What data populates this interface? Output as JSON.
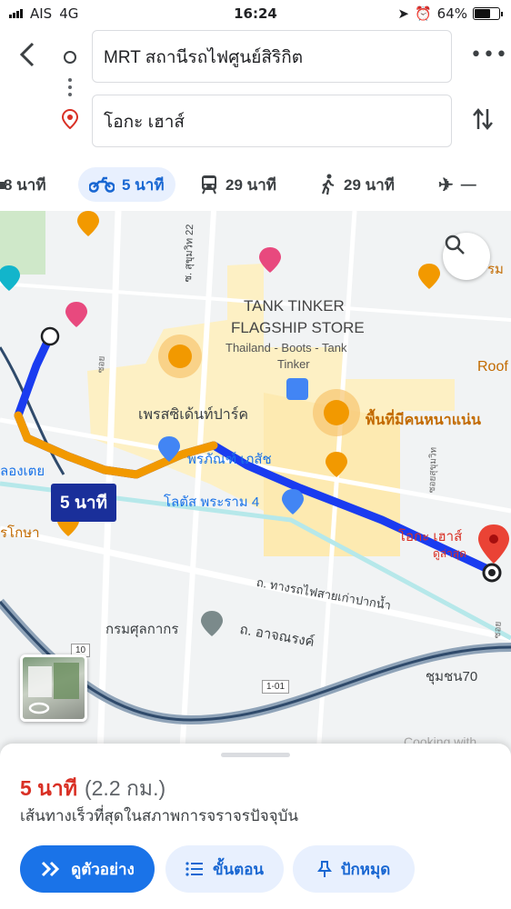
{
  "status_bar": {
    "carrier": "AIS",
    "network": "4G",
    "time": "16:24",
    "battery": "64%"
  },
  "route": {
    "origin": "MRT สถานีรถไฟศูนย์สิริกิต",
    "destination": "โอกะ เฮาส์"
  },
  "modes": [
    {
      "icon": "car-icon",
      "label": "8 นาที"
    },
    {
      "icon": "motorcycle-icon",
      "label": "5 นาที",
      "active": true
    },
    {
      "icon": "transit-icon",
      "label": "29 นาที"
    },
    {
      "icon": "walk-icon",
      "label": "29 นาที"
    },
    {
      "icon": "flight-icon",
      "label": "—"
    }
  ],
  "map": {
    "labels": {
      "tank_tinker_1": "TANK TINKER",
      "tank_tinker_2": "FLAGSHIP STORE",
      "thailand_boots": "Thailand - Boots - Tank",
      "tinker": "Tinker",
      "park": "เพรสซิเด้นท์ปาร์ค",
      "crowded": "พื้นที่มีคนหนาแน่น",
      "pharmacy": "พรภัณฑ์ เภสัช",
      "lotus": "โลตัส พระราม 4",
      "khlong_toei": "ลองเตย",
      "road_rail": "ถ. ทางรถไฟสายเก่าปากน้ำ",
      "customs": "กรมศุลกากร",
      "arjnarong": "ถ. อาจณรงค์",
      "chumchon": "ชุมชน70",
      "dest_name": "โอกะ เฮาส์",
      "dest_sub": "ดูล่าสุด",
      "roof": "Roof",
      "sukhumvit": "ซ. สุขุมวิท 22",
      "rongkoba": "รโกษา",
      "ram": "รม",
      "cooking": "Cooking with",
      "soi1": "ซอย",
      "soi2": "ซอย",
      "soi3": "ซอยสุขุมวิท",
      "road_10": "10",
      "road_101": "1-01"
    },
    "duration_badge": "5 นาที"
  },
  "sheet": {
    "duration": "5 นาที",
    "distance": "(2.2 กม.)",
    "description": "เส้นทางเร็วที่สุดในสภาพการจราจรปัจจุบัน",
    "buttons": {
      "preview": "ดูตัวอย่าง",
      "steps": "ขั้นตอน",
      "pin": "ปักหมุด"
    }
  },
  "colors": {
    "route_blue": "#1a3cf0",
    "traffic_orange": "#f29900",
    "accent": "#1a73e8",
    "duration_red": "#d93025"
  }
}
